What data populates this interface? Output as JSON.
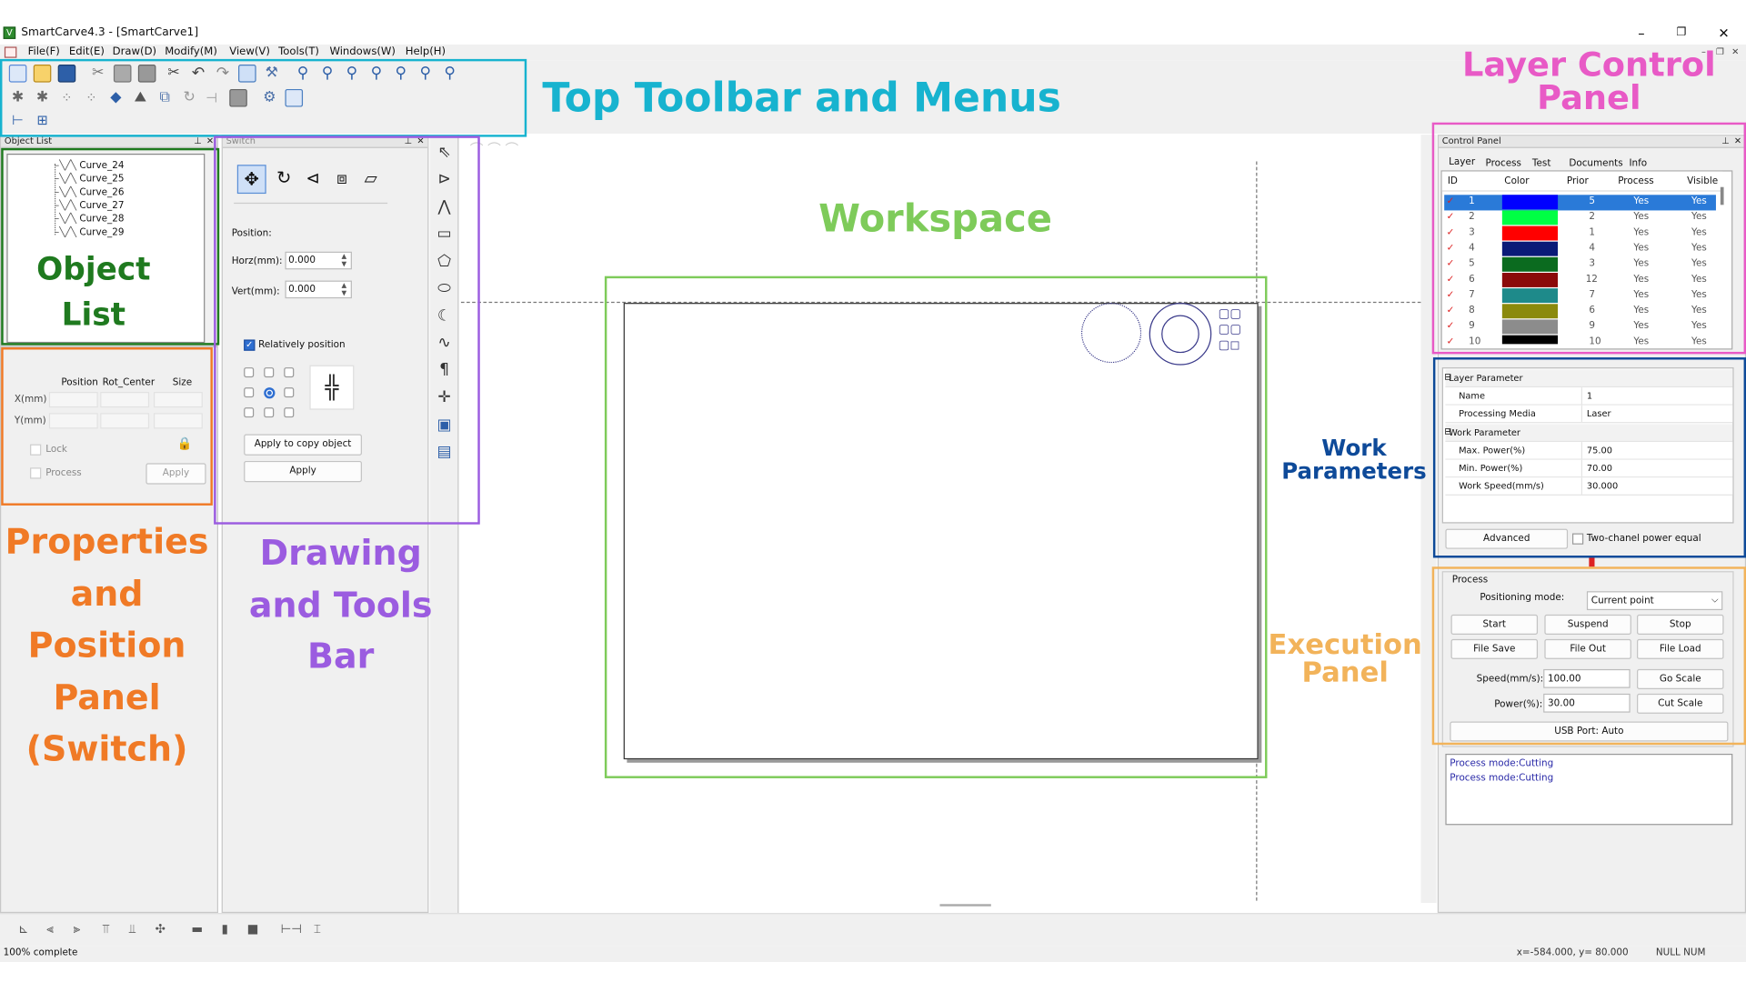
{
  "window": {
    "title": "SmartCarve4.3 - [SmartCarve1]",
    "app_icon": "V",
    "controls": [
      "–",
      "❐",
      "✕"
    ]
  },
  "menu": [
    "File(F)",
    "Edit(E)",
    "Draw(D)",
    "Modify(M)",
    "View(V)",
    "Tools(T)",
    "Windows(W)",
    "Help(H)"
  ],
  "object_list": {
    "title": "Object List",
    "items": [
      "Curve_24",
      "Curve_25",
      "Curve_26",
      "Curve_27",
      "Curve_28",
      "Curve_29"
    ]
  },
  "properties": {
    "columns": [
      "Position",
      "Rot_Center",
      "Size"
    ],
    "rows": [
      "X(mm)",
      "Y(mm)"
    ],
    "lock_label": "Lock",
    "process_label": "Process",
    "apply_label": "Apply"
  },
  "switch_panel": {
    "title": "Switch",
    "position_label": "Position:",
    "horz_label": "Horz(mm):",
    "horz_value": "0.000",
    "vert_label": "Vert(mm):",
    "vert_value": "0.000",
    "relative_label": "Relatively position",
    "relative_checked": true,
    "apply_copy_label": "Apply to copy object",
    "apply_label": "Apply"
  },
  "control_panel": {
    "title": "Control Panel",
    "tabs": [
      "Layer",
      "Process",
      "Test",
      "Documents",
      "Info"
    ],
    "columns": [
      "ID",
      "Color",
      "Prior",
      "Process",
      "Visible"
    ],
    "layers": [
      {
        "id": "1",
        "color": "#0000ff",
        "prior": "5",
        "process": "Yes",
        "visible": "Yes"
      },
      {
        "id": "2",
        "color": "#00ff44",
        "prior": "2",
        "process": "Yes",
        "visible": "Yes"
      },
      {
        "id": "3",
        "color": "#ff0000",
        "prior": "1",
        "process": "Yes",
        "visible": "Yes"
      },
      {
        "id": "4",
        "color": "#0a1a78",
        "prior": "4",
        "process": "Yes",
        "visible": "Yes"
      },
      {
        "id": "5",
        "color": "#0b6b1f",
        "prior": "3",
        "process": "Yes",
        "visible": "Yes"
      },
      {
        "id": "6",
        "color": "#8b0a0a",
        "prior": "12",
        "process": "Yes",
        "visible": "Yes"
      },
      {
        "id": "7",
        "color": "#1e8a8a",
        "prior": "7",
        "process": "Yes",
        "visible": "Yes"
      },
      {
        "id": "8",
        "color": "#8b8a0c",
        "prior": "6",
        "process": "Yes",
        "visible": "Yes"
      },
      {
        "id": "9",
        "color": "#8c8c8c",
        "prior": "9",
        "process": "Yes",
        "visible": "Yes"
      },
      {
        "id": "10",
        "color": "#000000",
        "prior": "10",
        "process": "Yes",
        "visible": "Yes"
      }
    ]
  },
  "layer_params": {
    "section1": "Layer Parameter",
    "name_label": "Name",
    "name_value": "1",
    "media_label": "Processing Media",
    "media_value": "Laser",
    "section2": "Work Parameter",
    "max_label": "Max. Power(%)",
    "max_value": "75.00",
    "min_label": "Min. Power(%)",
    "min_value": "70.00",
    "speed_label": "Work Speed(mm/s)",
    "speed_value": "30.000",
    "advanced_label": "Advanced",
    "two_channel_label": "Two-chanel power equal"
  },
  "process_panel": {
    "title": "Process",
    "positioning_label": "Positioning mode:",
    "positioning_value": "Current point",
    "start": "Start",
    "suspend": "Suspend",
    "stop": "Stop",
    "file_save": "File Save",
    "file_out": "File Out",
    "file_load": "File Load",
    "speed_label": "Speed(mm/s):",
    "speed_value": "100.00",
    "power_label": "Power(%):",
    "power_value": "30.00",
    "go_scale": "Go Scale",
    "cut_scale": "Cut Scale",
    "usb": "USB Port: Auto"
  },
  "log": [
    "Process mode:Cutting",
    "Process mode:Cutting"
  ],
  "status": {
    "left": "100% complete",
    "coords": "x=-584.000, y= 80.000",
    "indicators": "NULL NUM"
  },
  "annotations": {
    "toolbar": "Top Toolbar and Menus",
    "layer_control": "Layer Control Panel",
    "workspace": "Workspace",
    "object_list": "Object List",
    "properties": "Properties and Position Panel (Switch)",
    "drawing": "Drawing and Tools Bar",
    "work_params": "Work Parameters",
    "execution": "Execution Panel",
    "colors": {
      "toolbar": "#17b3cf",
      "layer_control": "#e85ac6",
      "workspace": "#7ecb5a",
      "object_list": "#1f7a1f",
      "properties": "#f07a26",
      "drawing": "#9b5ce0",
      "work_params": "#0e4a99",
      "execution": "#f2b35a"
    }
  }
}
